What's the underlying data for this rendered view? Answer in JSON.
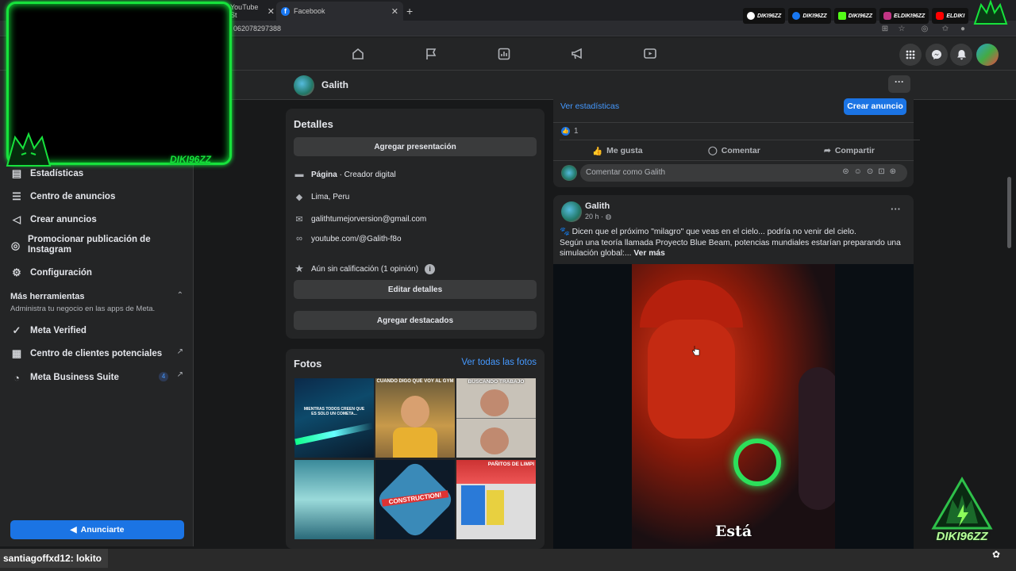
{
  "browser": {
    "tabs": [
      {
        "title": "YouTube St"
      },
      {
        "title": "Facebook"
      }
    ],
    "url": "062078297388"
  },
  "socials": [
    {
      "handle": "DIKI96ZZ",
      "color": "#ffffff"
    },
    {
      "handle": "DIKI96ZZ",
      "color": "#1877f2"
    },
    {
      "handle": "DIKI96ZZ",
      "color": "#53fc18"
    },
    {
      "handle": "ELDIKI96ZZ",
      "color": "#c13584"
    },
    {
      "handle": "ELDIKI",
      "color": "#ff0000"
    }
  ],
  "overlay": {
    "brand": "DIKI96ZZ",
    "corner_brand": "DIKI96ZZ"
  },
  "page": {
    "name": "Galith"
  },
  "sidebar": {
    "items": [
      {
        "label": "Estadísticas",
        "icon": "stats-icon"
      },
      {
        "label": "Centro de anuncios",
        "icon": "ads-center-icon"
      },
      {
        "label": "Crear anuncios",
        "icon": "megaphone-icon"
      },
      {
        "label": "Promocionar publicación de Instagram",
        "icon": "instagram-icon"
      },
      {
        "label": "Configuración",
        "icon": "gear-icon"
      }
    ],
    "more_tools": {
      "title": "Más herramientas",
      "subtitle": "Administra tu negocio en las apps de Meta."
    },
    "tools": [
      {
        "label": "Meta Verified",
        "icon": "verified-icon"
      },
      {
        "label": "Centro de clientes potenciales",
        "icon": "leads-icon"
      },
      {
        "label": "Meta Business Suite",
        "icon": "business-suite-icon",
        "badge": "4"
      }
    ],
    "cta": "Anunciarte"
  },
  "details": {
    "title": "Detalles",
    "add_intro": "Agregar presentación",
    "category_bold": "Página",
    "category_rest": " · Creador digital",
    "location": "Lima, Peru",
    "email": "galithtumejorversion@gmail.com",
    "website": "youtube.com/@Galith-f8o",
    "rating": "Aún sin calificación (1 opinión)",
    "edit": "Editar detalles",
    "featured": "Agregar destacados"
  },
  "photos": {
    "title": "Fotos",
    "see_all": "Ver todas las fotos",
    "captions": [
      "MIENTRAS TODOS CREEN QUE ES SOLO UN COMETA...",
      "CUANDO DIGO QUE VOY AL GYM",
      "BUSCANDO TRABAJO",
      "",
      "CONSTRUCTION!",
      "PAÑITOS DE LIMPI"
    ]
  },
  "post1": {
    "stats_link": "Ver estadísticas",
    "create_ad": "Crear anuncio",
    "like_count": "1",
    "like": "Me gusta",
    "comment": "Comentar",
    "share": "Compartir",
    "comment_placeholder": "Comentar como Galith"
  },
  "post2": {
    "author": "Galith",
    "time": "20 h · ",
    "line1": "🐾 Dicen que el próximo \"milagro\" que veas en el cielo... podría no venir del cielo.",
    "line2": "Según una teoría llamada Proyecto Blue Beam, potencias mundiales estarían preparando una",
    "line3": "simulación global:...",
    "see_more": "Ver más",
    "video_caption": "Está"
  },
  "chat": {
    "user": "santiagoffxd12",
    "message": " : lokito"
  },
  "colors": {
    "accent": "#1b74e4",
    "link": "#4599ff",
    "neon": "#17e23c"
  }
}
